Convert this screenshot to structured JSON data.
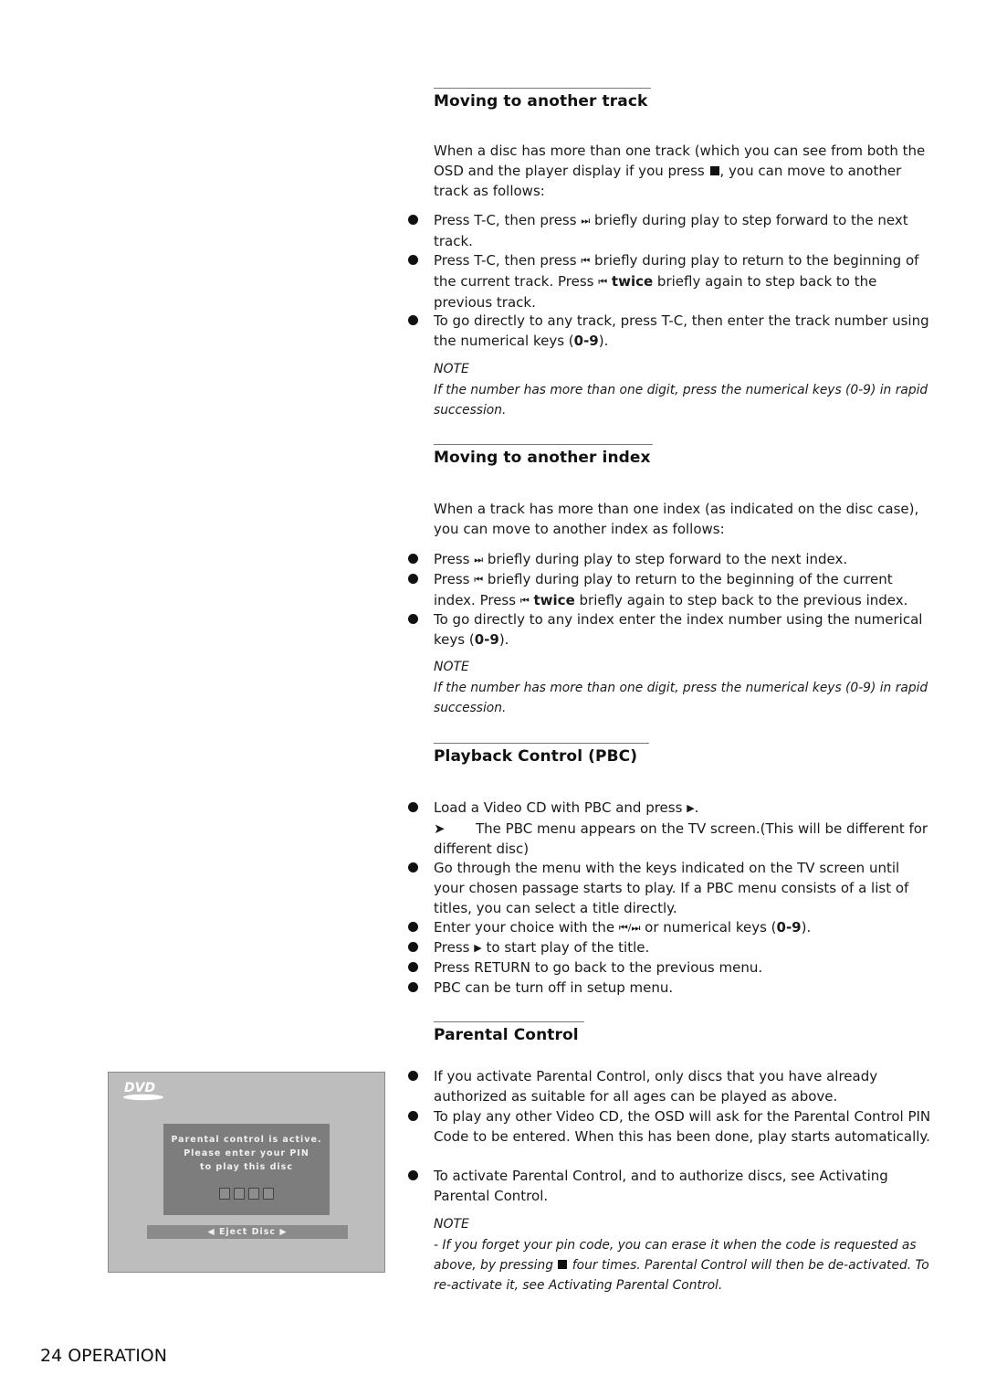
{
  "sections": {
    "track": {
      "title": "Moving to another track",
      "intro_a": "When a disc has more than one track (which you can see from both the OSD and the player display if you press ",
      "intro_b": ", you can move to another track as follows:",
      "b1_a": "Press T-C, then press ",
      "b1_b": " briefly during play to step forward to the next track.",
      "b2_a": "Press T-C, then press ",
      "b2_b": " briefly during play to return to the beginning of the current track. Press ",
      "b2_bold": "twice",
      "b2_c": " briefly again to step back to the previous track.",
      "b3_a": "To go directly to any track, press T-C, then enter the track number using the numerical keys (",
      "b3_bold": "0-9",
      "b3_b": ").",
      "note_label": "NOTE",
      "note_text": "If the number has more than one digit, press the numerical keys (0-9) in rapid succession."
    },
    "index": {
      "title": "Moving to another index",
      "intro": "When a track has more than one index (as indicated on the disc case), you can move to another index as follows:",
      "b1_a": "Press ",
      "b1_b": " briefly during play to step forward to the next index.",
      "b2_a": "Press ",
      "b2_b": " briefly during play to return to the beginning of the current index. Press ",
      "b2_bold": "twice",
      "b2_c": " briefly again to step back to the previous index.",
      "b3_a": "To go directly to any index enter the index number using the numerical keys (",
      "b3_bold": "0-9",
      "b3_b": ").",
      "note_label": "NOTE",
      "note_text": "If the number has more than one digit, press the numerical keys (0-9) in rapid succession."
    },
    "pbc": {
      "title": "Playback Control (PBC)",
      "b1_a": "Load a Video CD with PBC and press ",
      "b1_b": ".",
      "b1_result": "The PBC menu appears on the TV screen.(This will be different for different disc)",
      "b2": "Go through the menu with the keys indicated on the TV screen until your chosen passage starts to play. If a PBC menu consists of a list of titles, you can select a title directly.",
      "b3_a": "Enter your choice with the ",
      "b3_b": " or numerical keys (",
      "b3_bold": "0-9",
      "b3_c": ").",
      "b4_a": "Press ",
      "b4_b": " to start play of the title.",
      "b5": "Press RETURN to go back to the previous menu.",
      "b6": "PBC can be turn off in setup menu."
    },
    "parental": {
      "title": "Parental Control",
      "b1": "If you activate Parental Control, only discs that you have already authorized as suitable for all ages can be played as above.",
      "b2": "To play any other Video CD, the OSD will ask for the Parental Control PIN Code to be entered. When this has been done, play starts automatically.",
      "b3": "To activate Parental Control, and to authorize discs, see Activating Parental Control.",
      "note_label": "NOTE",
      "note_a": "- If you forget your pin code, you can erase it when the code is requested as above, by pressing ",
      "note_b": " four times. Parental Control will then be de-activated. To re-activate it, see Activating Parental Control."
    }
  },
  "glyphs": {
    "next": "⏭",
    "prev": "⏮",
    "play": "▶",
    "result_arrow": "➤",
    "prev_next": "⏮/⏭"
  },
  "osd": {
    "logo": "DVD",
    "line1": "Parental control is active.",
    "line2": "Please enter your PIN",
    "line3": "to play this disc",
    "pin_slots": 4,
    "eject_label": "◀ Eject Disc ▶"
  },
  "footer": {
    "page_label": "24 OPERATION"
  }
}
